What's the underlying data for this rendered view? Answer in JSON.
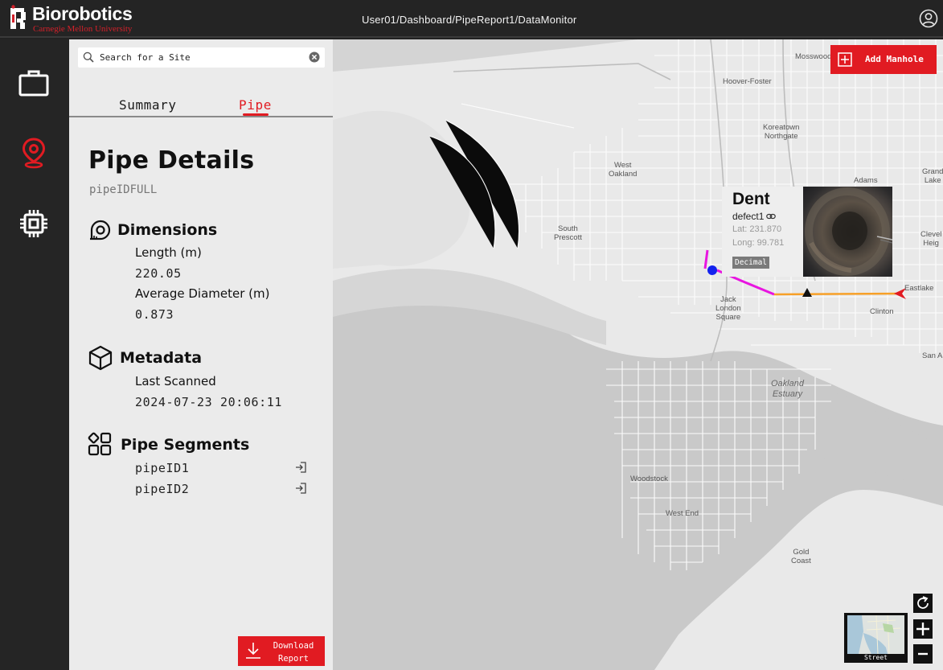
{
  "header": {
    "logo_name": "Biorobotics",
    "logo_sub": "Carnegie Mellon University",
    "breadcrumb": "User01/Dashboard/PipeReport1/DataMonitor"
  },
  "search": {
    "placeholder": "Search for a Site"
  },
  "tabs": [
    {
      "label": "Summary"
    },
    {
      "label": "Pipe"
    }
  ],
  "details": {
    "title": "Pipe Details",
    "pipe_id": "pipeIDFULL",
    "dimensions": {
      "title": "Dimensions",
      "length_label": "Length (m)",
      "length_value": "220.05",
      "diameter_label": "Average Diameter (m)",
      "diameter_value": "0.873"
    },
    "metadata": {
      "title": "Metadata",
      "scanned_label": "Last Scanned",
      "scanned_value": "2024-07-23 20:06:11"
    },
    "segments": {
      "title": "Pipe Segments",
      "items": [
        "pipeID1",
        "pipeID2"
      ]
    }
  },
  "download": {
    "line1": "Download",
    "line2": "Report"
  },
  "map": {
    "add_manhole": "Add Manhole",
    "labels": {
      "mosswood": "Mosswood",
      "hoover_foster": "Hoover-Foster",
      "koreatown": "Koreatown",
      "northgate": "Northgate",
      "west_oakland_1": "West",
      "west_oakland_2": "Oakland",
      "adams": "Adams",
      "grand_lake_1": "Grand",
      "grand_lake_2": "Lake",
      "south_prescott_1": "South",
      "south_prescott_2": "Prescott",
      "cleveland_1": "Clevel",
      "cleveland_2": "Heig",
      "jack_london_1": "Jack",
      "jack_london_2": "London",
      "jack_london_3": "Square",
      "eastlake": "Eastlake",
      "clinton": "Clinton",
      "san_antonio": "San A",
      "estuary_1": "Oakland",
      "estuary_2": "Estuary",
      "woodstock": "Woodstock",
      "west_end": "West End",
      "gold_coast_1": "Gold",
      "gold_coast_2": "Coast"
    },
    "popup": {
      "title": "Dent",
      "defect_id": "defect1",
      "lat": "Lat: 231.870",
      "long": "Long: 99.781",
      "button": "Decimal"
    },
    "minimap_label": "Street",
    "colors": {
      "pipe_segment_1": "#e815e0",
      "pipe_segment_2": "#f7a028",
      "accent": "#e11b22"
    }
  }
}
